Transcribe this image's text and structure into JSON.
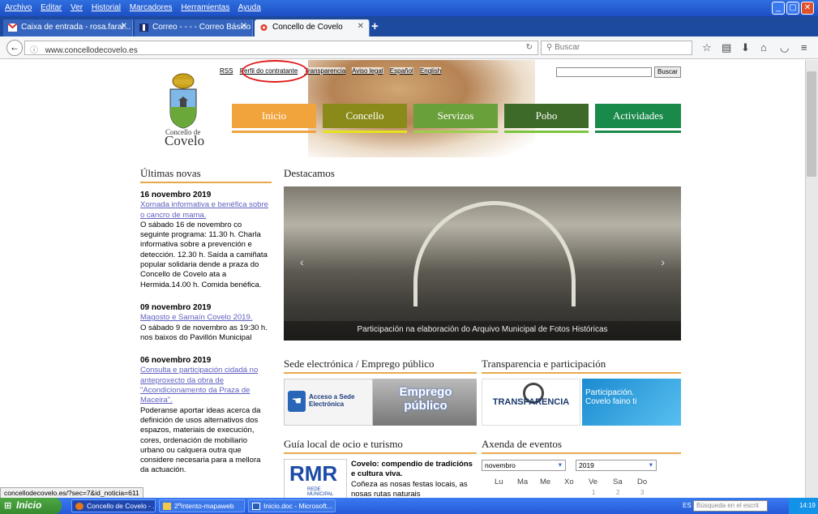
{
  "menubar": {
    "items": [
      "Archivo",
      "Editar",
      "Ver",
      "Historial",
      "Marcadores",
      "Herramientas",
      "Ayuda"
    ]
  },
  "tabs": [
    {
      "label": "Caixa de entrada - rosa.faral...",
      "icon": "gmail-icon"
    },
    {
      "label": "Correo - - - - Correo Básico",
      "icon": "mail-icon"
    },
    {
      "label": "Concello de Covelo",
      "icon": "flower-icon"
    }
  ],
  "navbar": {
    "url": "www.concellodecovelo.es",
    "search_placeholder": "Buscar"
  },
  "site": {
    "top_links": [
      "RSS",
      "Perfil do contratante",
      "Transparencia",
      "Aviso legal",
      "Español",
      "English"
    ],
    "search_button": "Buscar",
    "logo_small": "Concello de",
    "logo_big": "Covelo",
    "nav": [
      {
        "label": "Inicio",
        "color": "#f1a33c",
        "under": "#f1a33c"
      },
      {
        "label": "Concello",
        "color": "#8a8a1a",
        "under": "#e6e31b"
      },
      {
        "label": "Servizos",
        "color": "#6aa03a",
        "under": "#9cd04a"
      },
      {
        "label": "Pobo",
        "color": "#3d6a28",
        "under": "#7bc43c"
      },
      {
        "label": "Actividades",
        "color": "#1a8a4a",
        "under": "#1a8a4a"
      }
    ]
  },
  "news": {
    "title": "Últimas novas",
    "items": [
      {
        "date": "16 novembro 2019",
        "link": "Xornada informativa e benéfica sobre o cancro de mama.",
        "text": "O sábado 16 de novembro co seguinte programa: 11.30 h. Charla informativa sobre a prevención e detección. 12.30 h. Saída a camiñata popular solidaria dende a praza do Concello de Covelo ata a Hermida.14.00 h. Comida benéfica."
      },
      {
        "date": "09 novembro 2019",
        "link": "Magosto e Samaín Covelo 2019.",
        "text": "O sábado 9 de novembro as 19:30 h. nos baixos do Pavillón Municipal"
      },
      {
        "date": "06 novembro 2019",
        "link": "Consulta e participación cidadá no anteproxecto da obra de \"Acondicionamento da Praza de Maceira\".",
        "text": "Poderanse aportar ideas acerca da definición de usos alternativos dos espazos, materiais de execución, cores, ordenación de mobiliario urbano ou calquera outra que considere necesaria para a mellora da actuación."
      }
    ]
  },
  "featured": {
    "title": "Destacamos",
    "caption": "Participación na elaboración do Arquivo Municipal de Fotos Históricas"
  },
  "sections": {
    "sede_title": "Sede electrónica / Emprego público",
    "sede_banner": "Acceso a Sede Electrónica",
    "emprego_banner": "Emprego público",
    "transparencia_title": "Transparencia e participación",
    "transparencia_banner": "TRANSPARENCIA",
    "participacion_banner": "Participación. Covelo faino ti",
    "guia_title": "Guía local de ocio e turismo",
    "rmr_logo": "RMR",
    "rmr_sub": "REDE MUNICIPAL",
    "guia_headline": "Covelo: compendio de tradicións e cultura viva.",
    "guia_text": "Coñeza as nosas festas locais, as nosas rutas naturais",
    "axenda_title": "Axenda de eventos",
    "cal_month": "novembro",
    "cal_year": "2019",
    "cal_days": [
      "Lu",
      "Ma",
      "Me",
      "Xo",
      "Ve",
      "Sa",
      "Do"
    ],
    "cal_dates": [
      "1",
      "2",
      "3"
    ]
  },
  "status_url": "concellodecovelo.es/?sec=7&id_noticia=611",
  "taskbar": {
    "start": "Inicio",
    "items": [
      {
        "label": "Concello de Covelo - ..."
      },
      {
        "label": "2ºIntento-mapaweb"
      },
      {
        "label": "Inicio.doc - Microsoft..."
      }
    ],
    "lang": "ES",
    "search_placeholder": "Búsqueda en el escrit",
    "time": "14:19"
  }
}
